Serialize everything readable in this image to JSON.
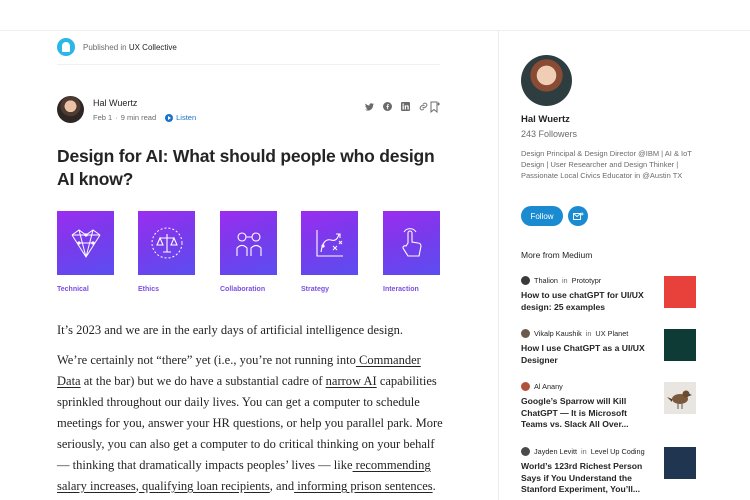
{
  "publication": {
    "prefix": "Published in",
    "name": "UX Collective"
  },
  "author": {
    "name": "Hal Wuertz",
    "date": "Feb 1",
    "read_time": "9 min read",
    "listen": "Listen",
    "sep": "·"
  },
  "article": {
    "title": "Design for AI: What should people who design AI know?",
    "tiles": [
      {
        "label": "Technical",
        "icon": "neural-heart-icon"
      },
      {
        "label": "Ethics",
        "icon": "scales-icon"
      },
      {
        "label": "Collaboration",
        "icon": "people-link-icon"
      },
      {
        "label": "Strategy",
        "icon": "strategy-play-icon"
      },
      {
        "label": "Interaction",
        "icon": "tap-hand-icon"
      }
    ],
    "p1": "It’s 2023 and we are in the early days of artificial intelligence design.",
    "p2": {
      "t1": "We’re certainly not “there” yet (i.e., you’re not running into",
      "l1": " Commander Data",
      "t2": " at the bar) but we do have a substantial cadre of ",
      "l2": "narrow AI",
      "t3": " capabilities sprinkled throughout our daily lives. You can get a computer to schedule meetings for you, answer your HR questions, or help you parallel park. More seriously, you can also get a computer to do critical thinking on your behalf — thinking that dramatically impacts peoples’ lives — like",
      "l3": " recommending salary increases",
      "t4": ",",
      "l4": " qualifying loan recipients",
      "t5": ", and",
      "l5": " informing prison sentences",
      "t6": "."
    }
  },
  "sidebar": {
    "name": "Hal Wuertz",
    "followers": "243 Followers",
    "bio": "Design Principal & Design Director @IBM | AI & IoT Design | User Researcher and Design Thinker | Passionate Local Civics Educator in @Austin TX",
    "follow_label": "Follow",
    "more_title": "More from Medium",
    "recommendations": [
      {
        "author": "Thalion",
        "in": "in",
        "publication": "Prototypr",
        "title": "How to use chatGPT for UI/UX design: 25 examples",
        "thumb_color": "#e8413c"
      },
      {
        "author": "Vikalp Kaushik",
        "in": "in",
        "publication": "UX Planet",
        "title": "How I use ChatGPT as a UI/UX Designer",
        "thumb_color": "#0e3b36"
      },
      {
        "author": "Al Anany",
        "in": "",
        "publication": "",
        "title": "Google’s Sparrow will Kill ChatGPT — It is Microsoft Teams vs. Slack All Over...",
        "thumb_color": "#d9d4cc"
      },
      {
        "author": "Jayden Levitt",
        "in": "in",
        "publication": "Level Up Coding",
        "title": "World’s 123rd Richest Person Says if You Understand the Stanford Experiment, You’ll...",
        "thumb_color": "#1f3550"
      }
    ]
  }
}
